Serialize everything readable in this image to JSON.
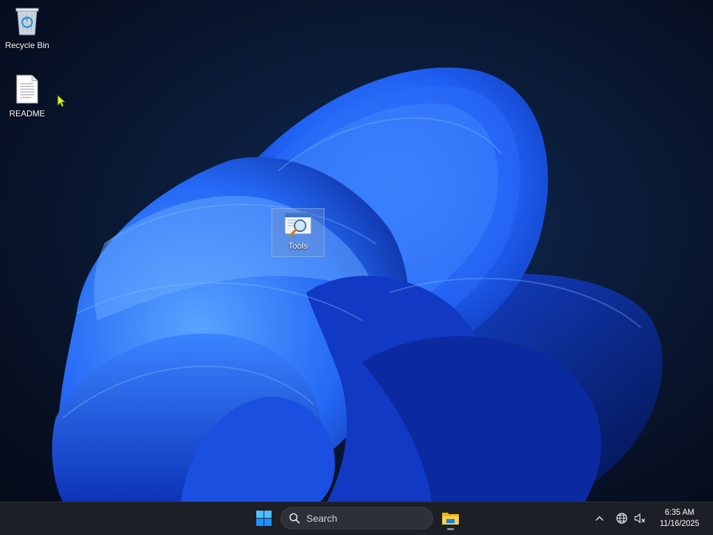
{
  "desktop": {
    "icons": [
      {
        "label": "Recycle Bin",
        "icon": "recycle-bin-icon"
      },
      {
        "label": "README",
        "icon": "text-document-icon"
      },
      {
        "label": "Tools",
        "icon": "tools-folder-icon",
        "selected": true
      }
    ]
  },
  "taskbar": {
    "search": {
      "label": "Search",
      "icon": "search-icon"
    },
    "start_icon": "windows-logo-icon",
    "pinned": [
      {
        "name": "File Explorer",
        "icon": "folder-icon",
        "running": true
      }
    ],
    "tray": {
      "chevron_icon": "chevron-up-icon",
      "network_icon": "globe-icon",
      "volume_icon": "speaker-muted-icon"
    },
    "clock": {
      "time": "6:35 AM",
      "date": "11/16/2025"
    }
  },
  "colors": {
    "taskbar_bg": "#1c1f26",
    "wallpaper_accent": "#1e5cff",
    "cursor": "#d8ff1a"
  }
}
